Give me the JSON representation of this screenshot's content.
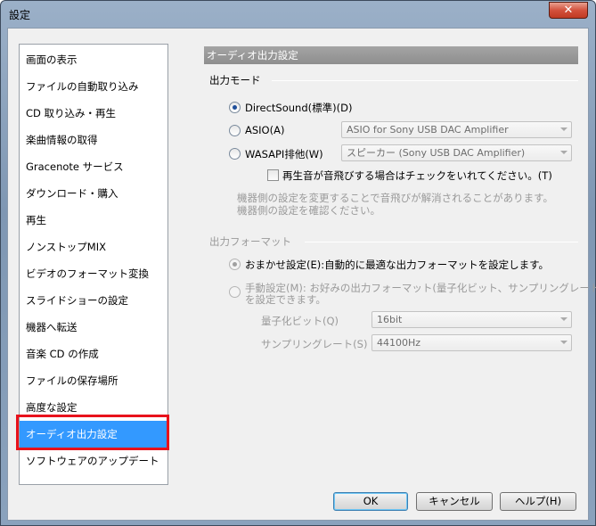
{
  "window": {
    "title": "設定",
    "close_glyph": "✕"
  },
  "sidebar": {
    "items": [
      {
        "label": "画面の表示"
      },
      {
        "label": "ファイルの自動取り込み"
      },
      {
        "label": "CD 取り込み・再生"
      },
      {
        "label": "楽曲情報の取得"
      },
      {
        "label": "Gracenote サービス"
      },
      {
        "label": "ダウンロード・購入"
      },
      {
        "label": "再生"
      },
      {
        "label": "ノンストップMIX"
      },
      {
        "label": "ビデオのフォーマット変換"
      },
      {
        "label": "スライドショーの設定"
      },
      {
        "label": "機器へ転送"
      },
      {
        "label": "音楽 CD の作成"
      },
      {
        "label": "ファイルの保存場所"
      },
      {
        "label": "高度な設定"
      },
      {
        "label": "オーディオ出力設定",
        "selected": true
      },
      {
        "label": "ソフトウェアのアップデート"
      }
    ]
  },
  "content": {
    "header": "オーディオ出力設定",
    "output_mode": {
      "group_label": "出力モード",
      "directsound": {
        "label": "DirectSound(標準)(D)",
        "checked": true
      },
      "asio": {
        "label": "ASIO(A)",
        "checked": false,
        "device": "ASIO for Sony USB DAC Amplifier"
      },
      "wasapi": {
        "label": "WASAPI排他(W)",
        "checked": false,
        "device": "スピーカー (Sony USB DAC Amplifier)"
      },
      "skip_check_label": "再生音が音飛びする場合はチェックをいれてください。(T)",
      "note_line1": "機器側の設定を変更することで音飛びが解消されることがあります。",
      "note_line2": "機器側の設定を確認ください。"
    },
    "output_format": {
      "group_label": "出力フォーマット",
      "auto": {
        "label": "おまかせ設定(E):自動的に最適な出力フォーマットを設定します。",
        "checked": true
      },
      "manual": {
        "label_line1": "手動設定(M):  お好みの出力フォーマット(量子化ビット、サンプリングレート)",
        "label_line2": "を設定できます。",
        "checked": false
      },
      "bit_depth": {
        "label": "量子化ビット(Q)",
        "value": "16bit"
      },
      "sample_rate": {
        "label": "サンプリングレート(S)",
        "value": "44100Hz"
      }
    }
  },
  "buttons": {
    "ok": "OK",
    "cancel": "キャンセル",
    "help": "ヘルプ(H)"
  }
}
